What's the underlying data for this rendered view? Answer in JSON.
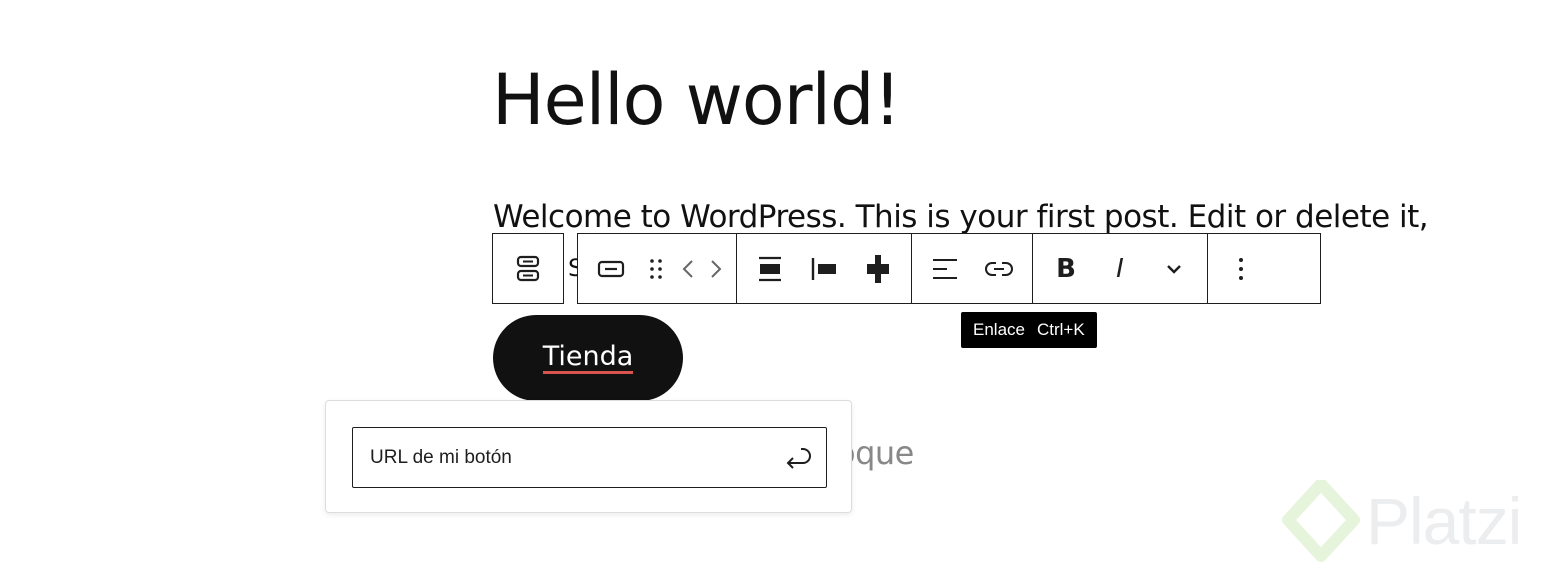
{
  "post": {
    "title": "Hello world!",
    "paragraph": "Welcome to WordPress. This is your first post. Edit or delete it,",
    "paragraph_clipped": "S"
  },
  "block_placeholder_tail": "oque",
  "toolbar": {
    "parent_icon": "buttons-block-icon",
    "groups": [
      [
        "button-block-icon",
        "drag-handle-icon",
        "move-arrows-icon"
      ],
      [
        "justify-center-icon",
        "justify-left-icon",
        "justify-stretch-icon"
      ],
      [
        "align-left-icon",
        "link-icon"
      ],
      [
        "bold",
        "italic",
        "chevron-down-icon"
      ],
      [
        "more-options-icon"
      ]
    ],
    "bold_label": "B",
    "italic_label": "I"
  },
  "tooltip": {
    "label": "Enlace",
    "shortcut": "Ctrl+K"
  },
  "button_block": {
    "label": "Tienda",
    "underline_color": "#d9534f"
  },
  "link_popover": {
    "url_value": "URL de mi botón",
    "submit_icon": "enter-arrow-icon"
  },
  "watermark": {
    "text": "Platzi"
  },
  "colors": {
    "text": "#111111",
    "toolbar_border": "#1e1e1e",
    "button_bg": "#111111",
    "tooltip_bg": "#000000"
  }
}
